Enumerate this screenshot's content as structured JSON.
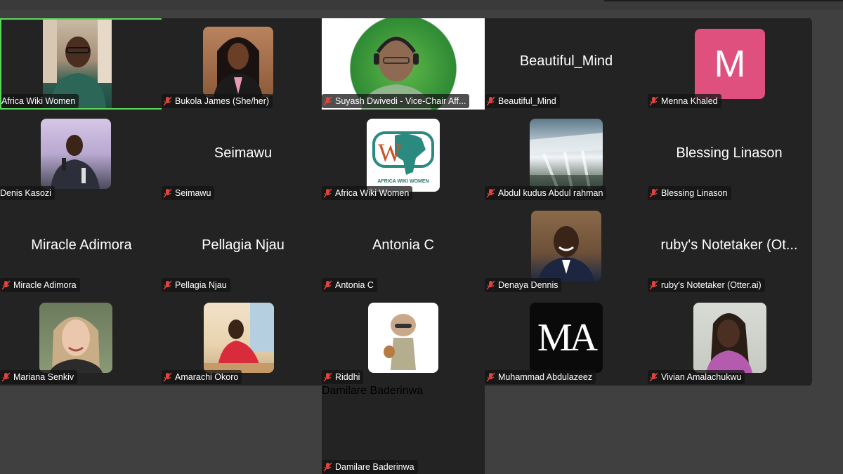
{
  "participants": [
    {
      "name": "Africa Wiki Women",
      "avatar": "person-glasses-green",
      "active": true
    },
    {
      "name": "Bukola James (She/her)",
      "avatar": "person-woman-portrait"
    },
    {
      "name": "Suyash Dwivedi - Vice-Chair Aff...",
      "avatar": "person-headset-green-bg"
    },
    {
      "name": "Beautiful_Mind",
      "display": "Beautiful_Mind"
    },
    {
      "name": "Menna Khaled",
      "avatar_letter": "M",
      "avatar_color": "#e0507e"
    },
    {
      "name": "Denis Kasozi",
      "avatar": "person-speaking-mic"
    },
    {
      "name": "Seimawu",
      "display": "Seimawu"
    },
    {
      "name": "Africa Wiki Women",
      "avatar": "africa-wiki-women-logo",
      "logo_caption": "AFRICA WIKI WOMEN"
    },
    {
      "name": "Abdul kudus Abdul rahman",
      "avatar": "waterfall-photo"
    },
    {
      "name": "Blessing Linason",
      "display": "Blessing Linason"
    },
    {
      "name": "Miracle Adimora",
      "display": "Miracle Adimora"
    },
    {
      "name": "Pellagia Njau",
      "display": "Pellagia Njau"
    },
    {
      "name": "Antonia C",
      "display": "Antonia C"
    },
    {
      "name": "Denaya Dennis",
      "avatar": "person-smiling-portrait"
    },
    {
      "name": "ruby's Notetaker (Otter.ai)",
      "display": "ruby's Notetaker (Ot..."
    },
    {
      "name": "Mariana Senkiv",
      "avatar": "person-blonde-portrait"
    },
    {
      "name": "Amarachi Okoro",
      "avatar": "person-red-dress"
    },
    {
      "name": "Riddhi",
      "avatar": "cartoon-girl-illustration"
    },
    {
      "name": "Muhammad Abdulazeez",
      "avatar": "ma-monogram-logo",
      "logo_text": "MA"
    },
    {
      "name": "Vivian Amalachukwu",
      "avatar": "person-braids-selfie"
    }
  ],
  "extra_participant": {
    "name": "Damilare Baderinwa",
    "display": "Damilare Baderinwa"
  },
  "colors": {
    "background": "#404040",
    "tile": "#232323",
    "active_border": "#5bd65b",
    "muted_icon": "#e0443e"
  }
}
